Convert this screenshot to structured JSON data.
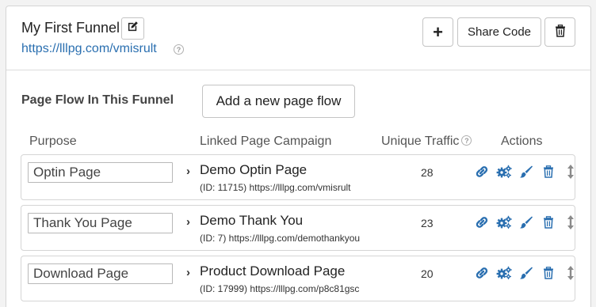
{
  "funnel": {
    "title": "My First Funnel",
    "url": "https://lllpg.com/vmisrult",
    "help_glyph": "?"
  },
  "header_buttons": {
    "add_label": "+",
    "share_label": "Share Code"
  },
  "section": {
    "title": "Page Flow In This Funnel",
    "add_flow_label": "Add a new page flow"
  },
  "columns": {
    "purpose": "Purpose",
    "linked": "Linked Page Campaign",
    "traffic": "Unique Traffic",
    "actions": "Actions"
  },
  "rows": [
    {
      "purpose": "Optin Page",
      "campaign": "Demo Optin Page",
      "detail": "(ID: 11715) https://lllpg.com/vmisrult",
      "traffic": "28"
    },
    {
      "purpose": "Thank You Page",
      "campaign": "Demo Thank You",
      "detail": "(ID: 7) https://lllpg.com/demothankyou",
      "traffic": "23"
    },
    {
      "purpose": "Download Page",
      "campaign": "Product Download Page",
      "detail": "(ID: 17999) https://lllpg.com/p8c81gsc",
      "traffic": "20"
    }
  ],
  "chevron": "›",
  "icons": [
    "edit-icon",
    "trash-icon",
    "link-icon",
    "gears-icon",
    "brush-icon",
    "move-vertical-icon",
    "help-icon"
  ],
  "colors": {
    "link": "#2a6fb0",
    "action_icon": "#2a6fb0",
    "border": "#d5d5d5"
  }
}
